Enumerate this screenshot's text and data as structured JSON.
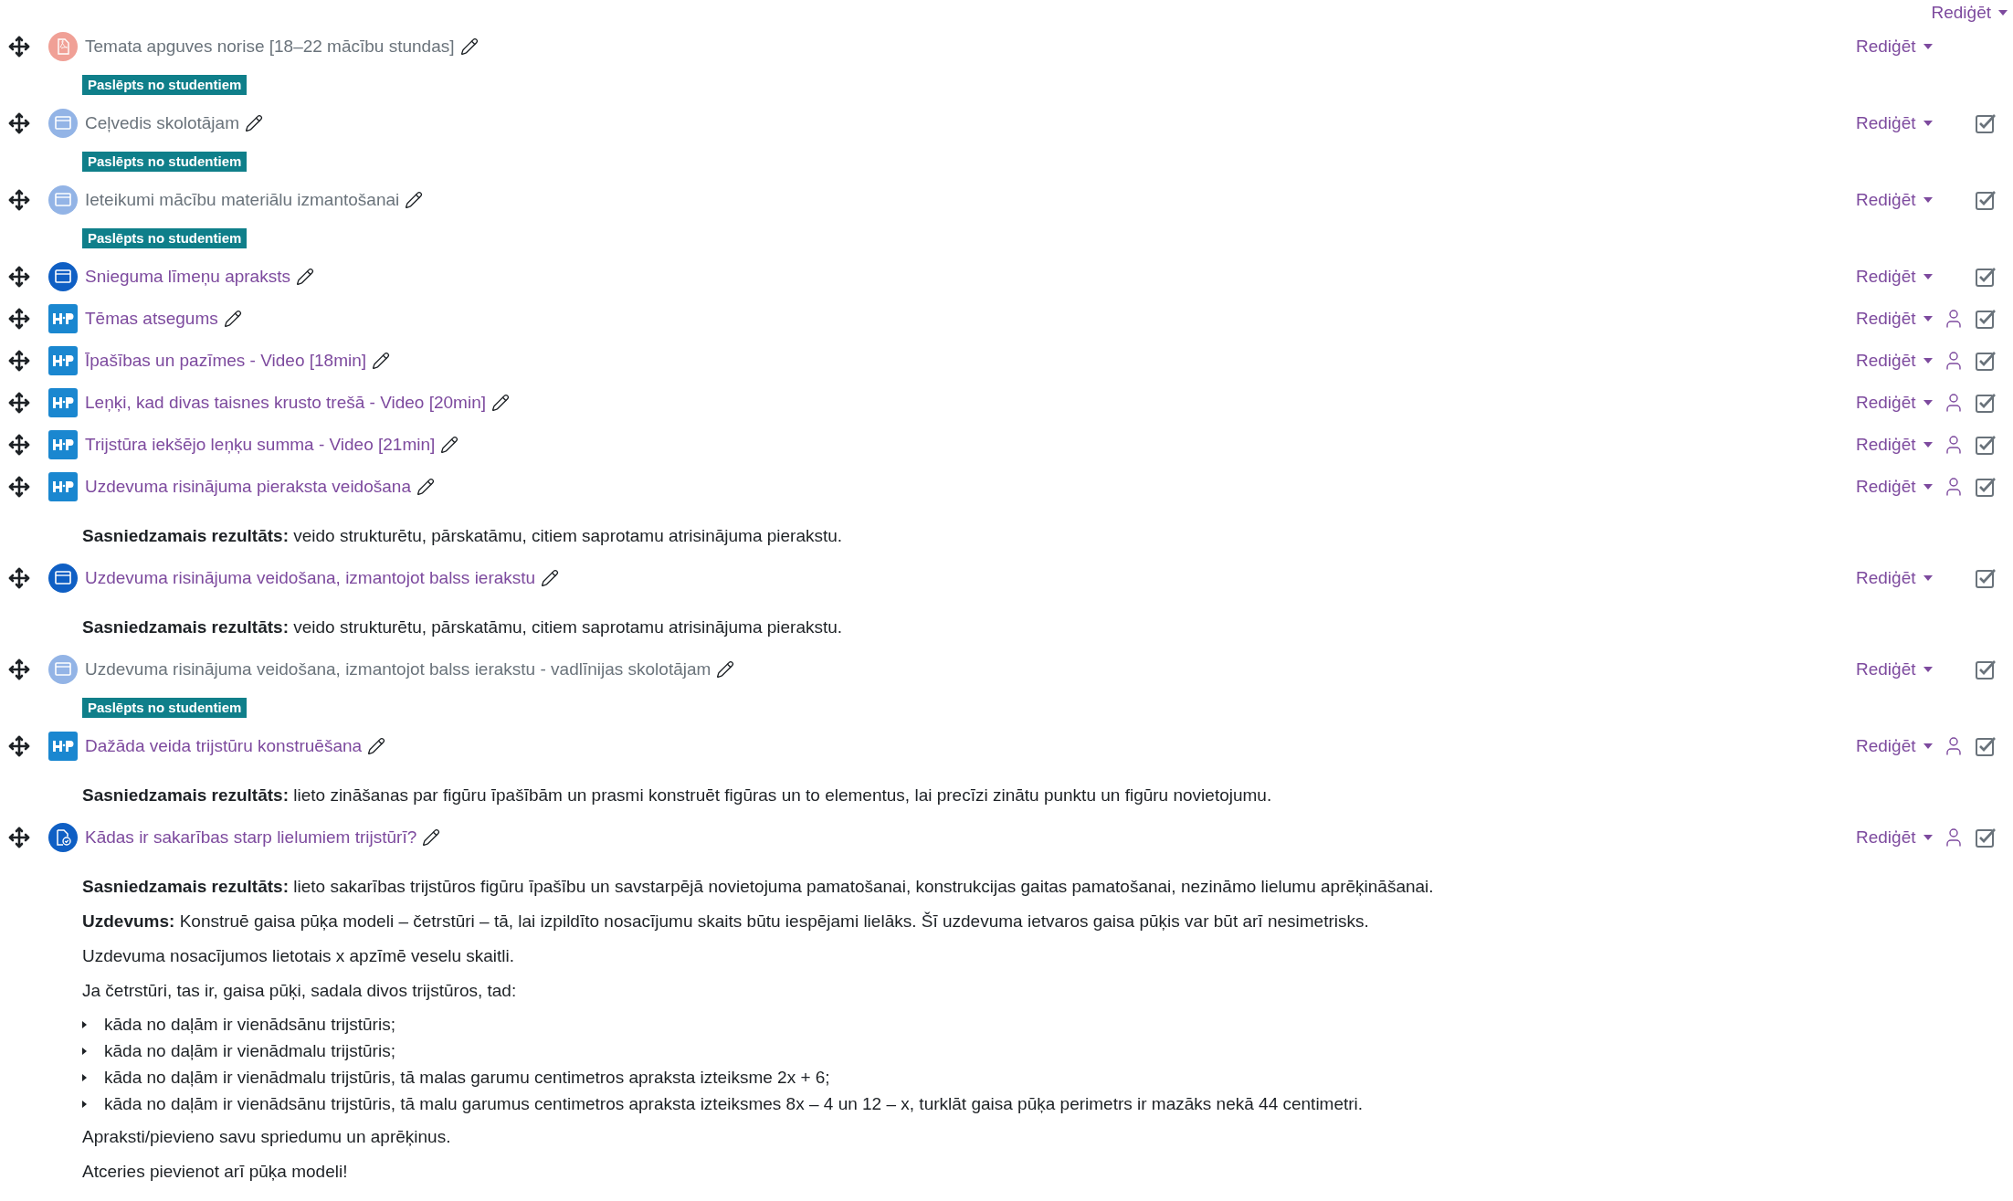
{
  "header": {
    "edit_label": "Rediģēt"
  },
  "items": [
    {
      "kind": "pdf",
      "title": "Temata apguves norise [18–22 mācību stundas]",
      "hidden": true,
      "edit_label": "Rediģēt",
      "access_icon": false,
      "completion": false,
      "badge": "Paslēpts no studentiem"
    },
    {
      "kind": "page",
      "title": "Ceļvedis skolotājam",
      "hidden": true,
      "edit_label": "Rediģēt",
      "access_icon": false,
      "completion": true,
      "badge": "Paslēpts no studentiem"
    },
    {
      "kind": "page",
      "title": "Ieteikumi mācību materiālu izmantošanai",
      "hidden": true,
      "edit_label": "Rediģēt",
      "access_icon": false,
      "completion": true,
      "badge": "Paslēpts no studentiem"
    },
    {
      "kind": "page",
      "title": "Snieguma līmeņu apraksts",
      "hidden": false,
      "edit_label": "Rediģēt",
      "access_icon": false,
      "completion": true
    },
    {
      "kind": "h5p",
      "title": "Tēmas atsegums",
      "hidden": false,
      "edit_label": "Rediģēt",
      "access_icon": true,
      "completion": true
    },
    {
      "kind": "h5p",
      "title": "Īpašības un pazīmes - Video [18min]",
      "hidden": false,
      "edit_label": "Rediģēt",
      "access_icon": true,
      "completion": true
    },
    {
      "kind": "h5p",
      "title": "Leņķi, kad divas taisnes krusto trešā - Video [20min]",
      "hidden": false,
      "edit_label": "Rediģēt",
      "access_icon": true,
      "completion": true
    },
    {
      "kind": "h5p",
      "title": "Trijstūra iekšējo leņķu summa - Video [21min]",
      "hidden": false,
      "edit_label": "Rediģēt",
      "access_icon": true,
      "completion": true
    },
    {
      "kind": "h5p",
      "title": "Uzdevuma risinājuma pieraksta veidošana",
      "hidden": false,
      "edit_label": "Rediģēt",
      "access_icon": true,
      "completion": true,
      "notes": [
        {
          "kind": "para",
          "text": "**Sasniedzamais rezultāts:** veido strukturētu, pārskatāmu, citiem saprotamu atrisinājuma pierakstu."
        }
      ]
    },
    {
      "kind": "page",
      "title": "Uzdevuma risinājuma veidošana, izmantojot balss ierakstu",
      "hidden": false,
      "edit_label": "Rediģēt",
      "access_icon": false,
      "completion": true,
      "notes": [
        {
          "kind": "para",
          "text": "**Sasniedzamais rezultāts:** veido strukturētu, pārskatāmu, citiem saprotamu atrisinājuma pierakstu."
        }
      ]
    },
    {
      "kind": "page",
      "title": "Uzdevuma risinājuma veidošana, izmantojot balss ierakstu - vadlīnijas skolotājam",
      "hidden": true,
      "edit_label": "Rediģēt",
      "access_icon": false,
      "completion": true,
      "badge": "Paslēpts no studentiem"
    },
    {
      "kind": "h5p",
      "title": "Dažāda veida trijstūru konstruēšana",
      "hidden": false,
      "edit_label": "Rediģēt",
      "access_icon": true,
      "completion": true,
      "notes": [
        {
          "kind": "para",
          "text": "**Sasniedzamais rezultāts:** lieto zināšanas par figūru īpašībām un prasmi konstruēt figūras un to elementus, lai precīzi zinātu punktu un figūru novietojumu."
        }
      ]
    },
    {
      "kind": "assign",
      "title": "Kādas ir sakarības starp lielumiem trijstūrī?",
      "hidden": false,
      "edit_label": "Rediģēt",
      "access_icon": true,
      "completion": true,
      "notes": [
        {
          "kind": "para",
          "text": "**Sasniedzamais rezultāts:** lieto sakarības trijstūros figūru īpašību un savstarpējā novietojuma pamatošanai, konstrukcijas gaitas pamatošanai, nezināmo lielumu aprēķināšanai."
        },
        {
          "kind": "para",
          "text": "**Uzdevums:** Konstruē gaisa pūķa modeli – četrstūri – tā, lai izpildīto nosacījumu skaits būtu iespējami lielāks. Šī uzdevuma ietvaros gaisa pūķis var būt arī nesimetrisks."
        },
        {
          "kind": "para",
          "text": "Uzdevuma nosacījumos lietotais x apzīmē veselu skaitli."
        },
        {
          "kind": "para",
          "text": "Ja četrstūri, tas ir, gaisa pūķi, sadala divos trijstūros, tad:"
        },
        {
          "kind": "bullets",
          "items": [
            "kāda no daļām ir vienādsānu trijstūris;",
            "kāda no daļām ir vienādmalu trijstūris;",
            "kāda no daļām ir vienādmalu trijstūris, tā malas garumu centimetros apraksta izteiksme 2x + 6;",
            "kāda no daļām ir vienādsānu trijstūris, tā malu garumus centimetros apraksta izteiksmes 8x – 4 un 12 – x, turklāt gaisa pūķa perimetrs ir mazāks nekā 44 centimetri."
          ]
        },
        {
          "kind": "para",
          "text": "Apraksti/pievieno savu spriedumu un aprēķinus."
        },
        {
          "kind": "para",
          "text": "Atceries pievienot arī pūķa modeli!"
        }
      ]
    }
  ]
}
